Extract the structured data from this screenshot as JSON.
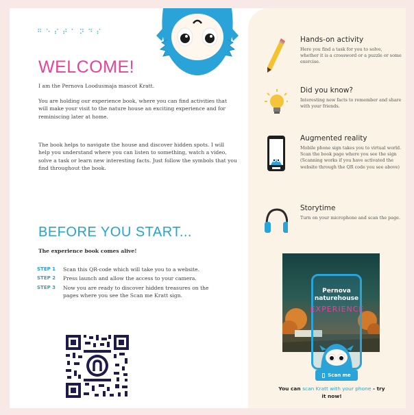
{
  "left": {
    "braille": "⠛⠑⠎⠞⠁⠝⠙⠎",
    "welcome_title": "WELCOME!",
    "intro": "I am the Pernova Loodusmaja mascot Kratt.",
    "para2": "You are holding our experience book, where you can find activities that will make your visit to the nature house an exciting experience and for reminiscing later at home.",
    "para3": "The book helps to navigate the house and discover hidden spots. I will help you understand where you can listen to something, watch a video, solve a task or learn new interesting facts. Just follow the symbols that you find throughout the book.",
    "before_title": "BEFORE YOU START...",
    "subhead": "The experience book comes alive!",
    "steps": [
      {
        "label": "STEP 1",
        "text": "Scan this QR-code which will take you to a website."
      },
      {
        "label": "STEP 2",
        "text": "Press launch and allow the access to your camera."
      },
      {
        "label": "STEP 3",
        "text": "Now you are ready to discover hidden treasures on the pages where you see the Scan me Kratt sign."
      }
    ]
  },
  "features": [
    {
      "icon": "pencil-icon",
      "title": "Hands-on activity",
      "desc": "Here you find a task for you to solve, whether it is a crossword or a puzzle or some exercise."
    },
    {
      "icon": "lightbulb-icon",
      "title": "Did you know?",
      "desc": "Interesting new facts to remember and share with your friends."
    },
    {
      "icon": "phone-icon",
      "title": "Augmented reality",
      "desc": "Mobile phone sign takes you to virtual world. Scan the book page where you see the sign (Scanning works if you have activated the website through the QR code you see above)"
    },
    {
      "icon": "headphones-icon",
      "title": "Storytime",
      "desc": "Turn on your microphone and scan the page."
    }
  ],
  "cover": {
    "line1": "Pernova",
    "line2": "naturehouse",
    "line3": "EXPERIENCE"
  },
  "scan_button": "Scan me",
  "cta": {
    "pre": "You can ",
    "highlight": "scan Kratt with your phone",
    "post": " - try it now!"
  },
  "colors": {
    "pink": "#e6429a",
    "blue": "#26a3d1",
    "cream": "#fbf4e6",
    "background": "#f8e9e6"
  }
}
